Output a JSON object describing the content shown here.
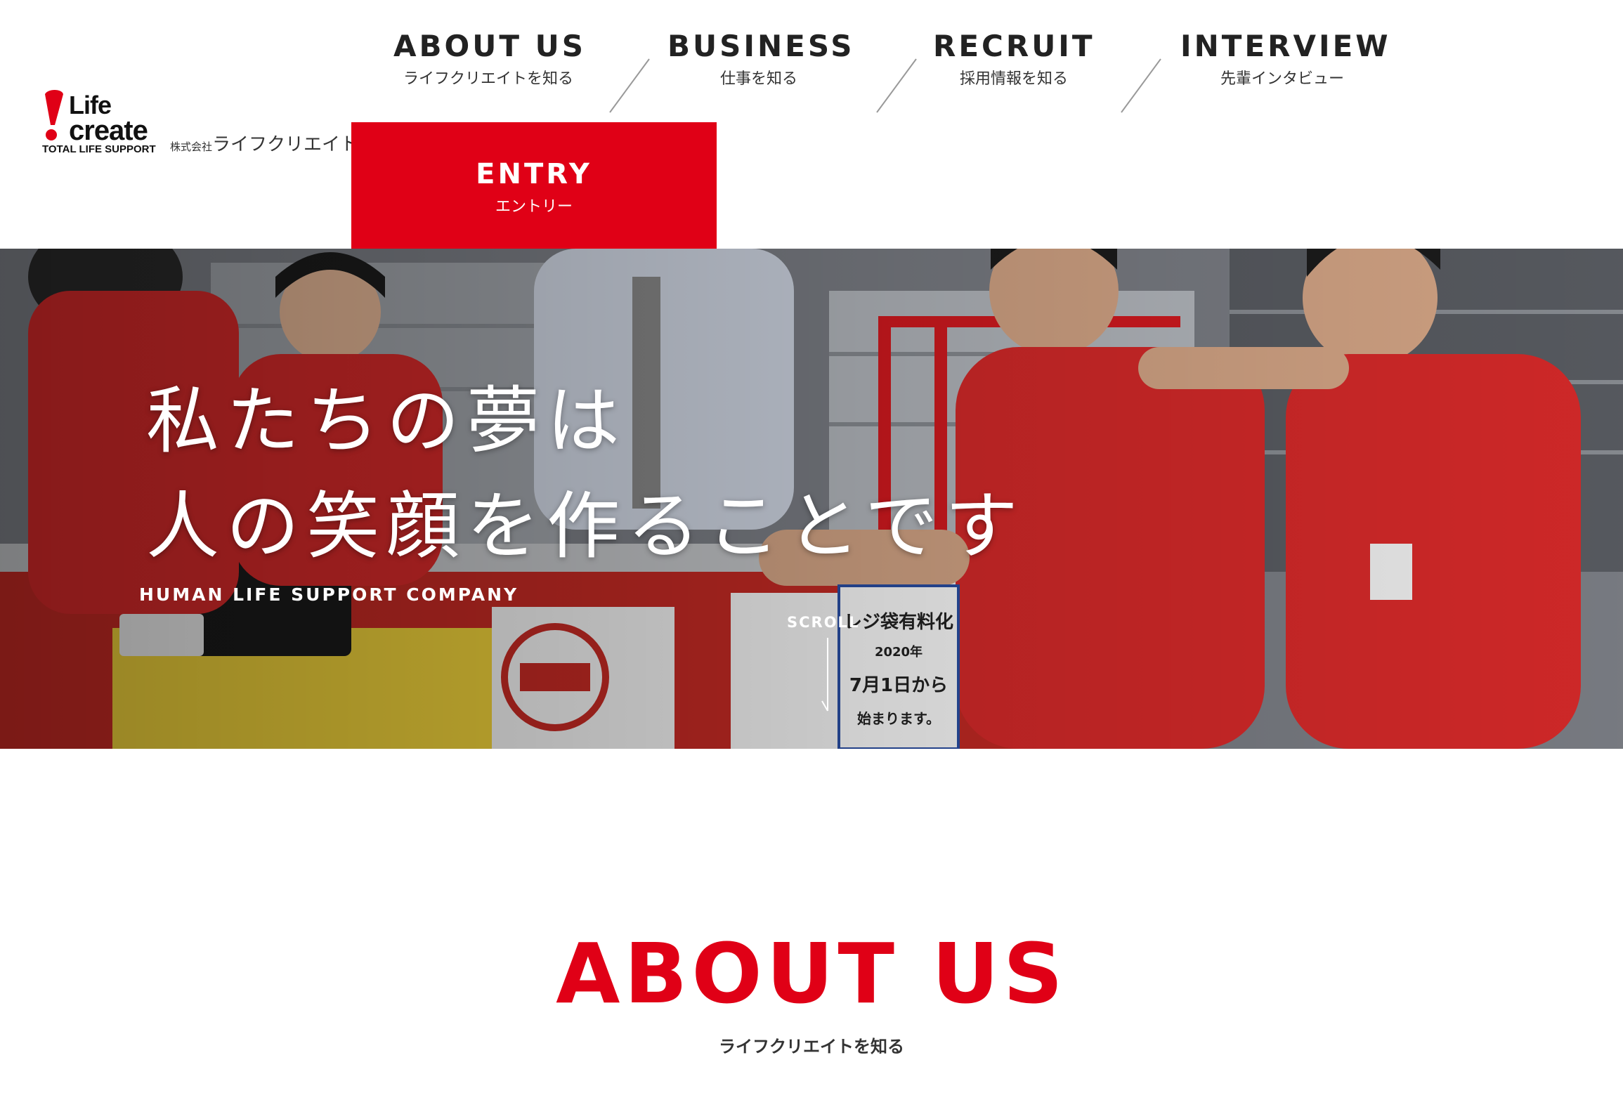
{
  "logo": {
    "line1": "Life",
    "line2": "create",
    "tagline": "TOTAL LIFE SUPPORT",
    "company_prefix": "株式会社",
    "company_name": "ライフクリエイト",
    "brand_color": "#e00016"
  },
  "nav": {
    "items": [
      {
        "en": "ABOUT US",
        "jp": "ライフクリエイトを知る"
      },
      {
        "en": "BUSINESS",
        "jp": "仕事を知る"
      },
      {
        "en": "RECRUIT",
        "jp": "採用情報を知る"
      },
      {
        "en": "INTERVIEW",
        "jp": "先輩インタビュー"
      }
    ],
    "entry": {
      "en": "ENTRY",
      "jp": "エントリー"
    }
  },
  "hero": {
    "catch_line1": "私たちの夢は",
    "catch_line2": "人の笑顔を作ることです",
    "tagline": "HUMAN LIFE SUPPORT COMPANY",
    "scroll_label": "SCROLL",
    "sign_text": "レジ袋有料化",
    "sign_year": "2020年",
    "sign_date": "7月1日から",
    "sign_footer": "始まります。"
  },
  "about": {
    "title": "ABOUT US",
    "subtitle": "ライフクリエイトを知る"
  }
}
